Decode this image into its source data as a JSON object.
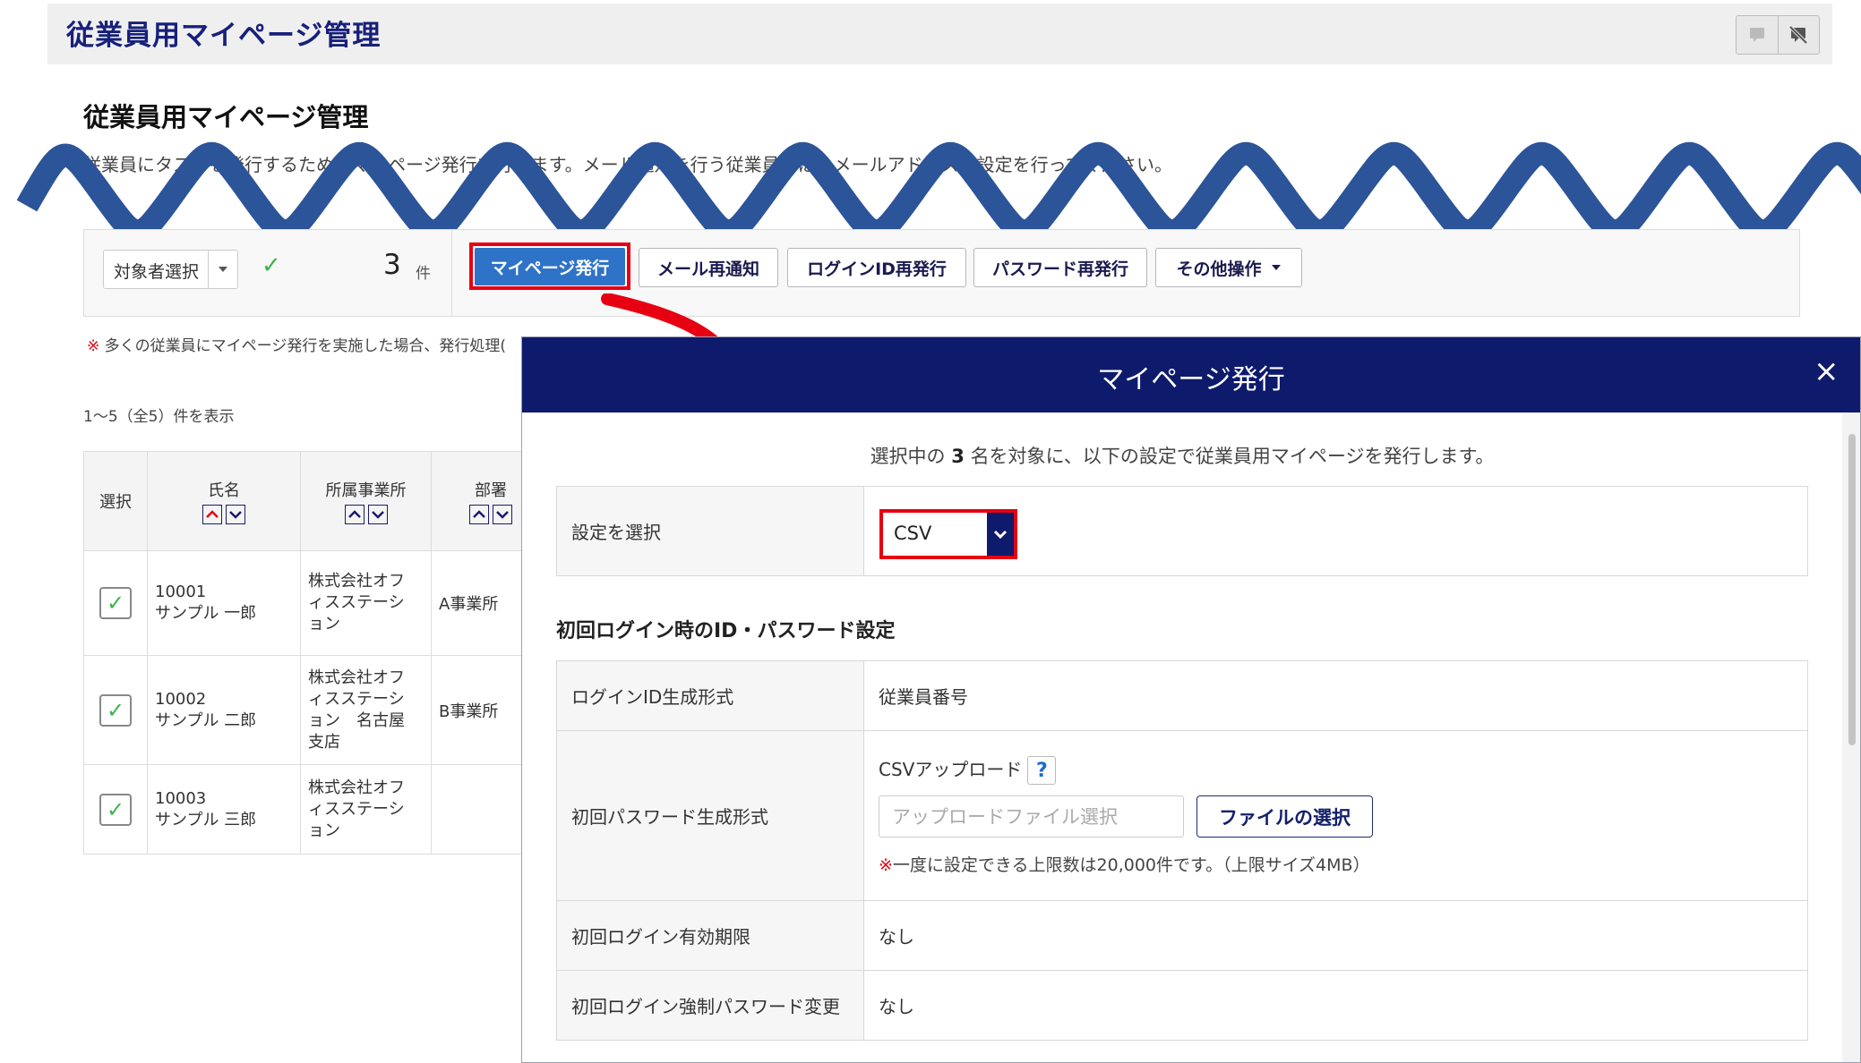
{
  "header": {
    "title": "従業員用マイページ管理"
  },
  "page": {
    "title": "従業員用マイページ管理",
    "description": "従業員にタスクを発行するためのマイページ発行を行います。メール通知を行う従業員には、メールアドレスの設定を行ってください。"
  },
  "toolbar": {
    "target_select_label": "対象者選択",
    "selected_count": "3",
    "count_unit": "件",
    "buttons": {
      "issue_mypage": "マイページ発行",
      "resend_mail": "メール再通知",
      "reissue_login_id": "ログインID再発行",
      "reissue_password": "パスワード再発行",
      "other_ops": "その他操作"
    }
  },
  "note": {
    "mark": "※",
    "text": "多くの従業員にマイページ発行を実施した場合、発行処理("
  },
  "list_range": "1〜5（全5）件を表示",
  "table": {
    "headers": {
      "select": "選択",
      "name": "氏名",
      "office": "所属事業所",
      "dept": "部署"
    },
    "rows": [
      {
        "id": "10001",
        "name": "サンプル 一郎",
        "office_lines": [
          "株式会社オフ",
          "ィスステーシ",
          "ョン"
        ],
        "dept": "A事業所",
        "checked": true
      },
      {
        "id": "10002",
        "name": "サンプル 二郎",
        "office_lines": [
          "株式会社オフ",
          "ィスステーシ",
          "ョン　名古屋",
          "支店"
        ],
        "dept": "B事業所",
        "checked": true
      },
      {
        "id": "10003",
        "name": "サンプル 三郎",
        "office_lines": [
          "株式会社オフ",
          "ィスステーシ",
          "ョン"
        ],
        "dept": "",
        "checked": true
      }
    ]
  },
  "modal": {
    "title": "マイページ発行",
    "close": "×",
    "intro_prefix": "選択中の",
    "intro_count": "3",
    "intro_suffix": "名を対象に、以下の設定で従業員用マイページを発行します。",
    "setting_label": "設定を選択",
    "setting_value": "CSV",
    "section_title": "初回ログイン時のID・パスワード設定",
    "rows": {
      "login_id_format_label": "ログインID生成形式",
      "login_id_format_value": "従業員番号",
      "initial_password_label": "初回パスワード生成形式",
      "csv_upload_label": "CSVアップロード",
      "help": "?",
      "upload_placeholder": "アップロードファイル選択",
      "file_button": "ファイルの選択",
      "limit_mark": "※",
      "limit_text": "一度に設定できる上限数は20,000件です。（上限サイズ4MB）",
      "expiry_label": "初回ログイン有効期限",
      "expiry_value": "なし",
      "force_change_label": "初回ログイン強制パスワード変更",
      "force_change_value": "なし"
    }
  },
  "colors": {
    "navy": "#0e1a6b",
    "primary_button": "#2f73c8",
    "highlight_red": "#e60012",
    "wave_blue": "#2b5499",
    "check_green": "#3bb54a"
  }
}
